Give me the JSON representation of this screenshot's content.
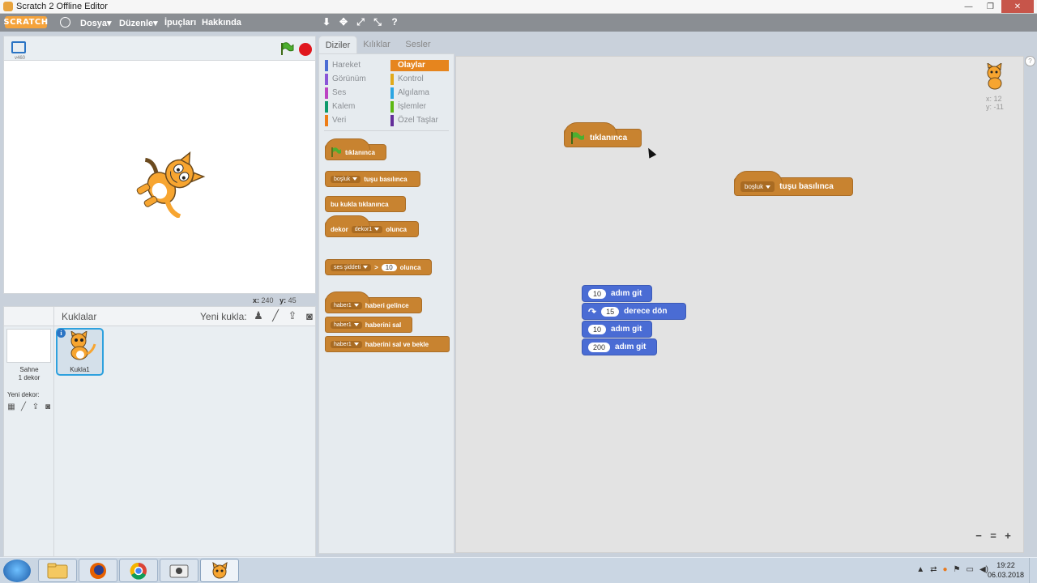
{
  "window": {
    "title": "Scratch 2 Offline Editor"
  },
  "menubar": {
    "logo": "SCRATCH",
    "items": [
      "Dosya▾",
      "Düzenle▾",
      "İpuçları",
      "Hakkında"
    ]
  },
  "stage": {
    "version": "v460",
    "coords": {
      "x_label": "x:",
      "x": "240",
      "y_label": "y:",
      "y": "45"
    }
  },
  "sprites": {
    "title": "Kuklalar",
    "new_sprite_label": "Yeni kukla:",
    "stage_name": "Sahne",
    "stage_backdrops": "1 dekor",
    "new_backdrop_label": "Yeni dekor:",
    "sprite_name": "Kukla1"
  },
  "palette": {
    "tabs": [
      "Diziler",
      "Kılıklar",
      "Sesler"
    ],
    "categories_left": [
      {
        "name": "Hareket",
        "color": "#4a6cd4"
      },
      {
        "name": "Görünüm",
        "color": "#8a55d7"
      },
      {
        "name": "Ses",
        "color": "#bb42c3"
      },
      {
        "name": "Kalem",
        "color": "#0e9a6c"
      },
      {
        "name": "Veri",
        "color": "#ee7d16"
      }
    ],
    "categories_right": [
      {
        "name": "Olaylar",
        "color": "#c88330",
        "active": true
      },
      {
        "name": "Kontrol",
        "color": "#e1a91a"
      },
      {
        "name": "Algılama",
        "color": "#2ca5e2"
      },
      {
        "name": "İşlemler",
        "color": "#5cb712"
      },
      {
        "name": "Özel Taşlar",
        "color": "#632d99"
      }
    ],
    "blocks": {
      "flag_clicked": "tıklanınca",
      "key_dd": "boşluk",
      "key_text": "tuşu basılınca",
      "sprite_clicked": "bu kukla tıklanınca",
      "backdrop_text1": "dekor",
      "backdrop_dd": "dekor1",
      "backdrop_text2": "olunca",
      "sensor_dd": "ses şiddeti",
      "sensor_gt": ">",
      "sensor_num": "10",
      "sensor_text": "olunca",
      "msg_dd": "haber1",
      "receive_text": "haberi gelince",
      "broadcast_text": "haberini sal",
      "broadcast_wait_text": "haberini sal ve bekle"
    }
  },
  "scripts": {
    "hat_flag": "tıklanınca",
    "hat_key_dd": "boşluk",
    "hat_key_text": "tuşu basılınca",
    "motion": [
      {
        "num": "10",
        "text": "adım git"
      },
      {
        "num": "15",
        "text": "derece dön"
      },
      {
        "num": "10",
        "text": "adım git"
      },
      {
        "num": "200",
        "text": "adım git"
      }
    ],
    "sprite_x": "x: 12",
    "sprite_y": "y: -11"
  },
  "taskbar": {
    "time": "19:22",
    "date": "06.03.2018"
  },
  "colors": {
    "events": "#c88330",
    "motion": "#4a6cd4",
    "menubar": "#8a8e93",
    "stop": "#e0171e"
  }
}
